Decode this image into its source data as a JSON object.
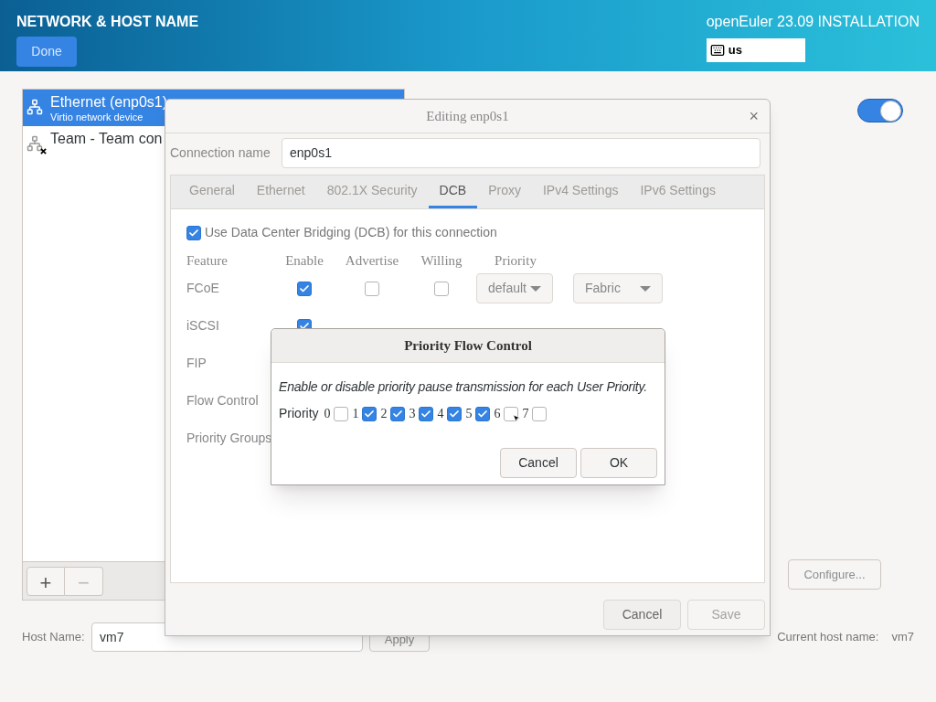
{
  "header": {
    "title": "NETWORK & HOST NAME",
    "done_button": "Done",
    "product": "openEuler 23.09 INSTALLATION",
    "keyboard_layout": "us"
  },
  "devices": [
    {
      "name": "Ethernet (enp0s1)",
      "detail": "Virtio network device",
      "selected": true,
      "connected": true
    },
    {
      "name": "Team - Team con",
      "selected": false,
      "connected": false
    }
  ],
  "device_toolbar": {
    "add": "+",
    "remove": "−"
  },
  "device_switch": {
    "on": true
  },
  "configure_button": "Configure...",
  "host": {
    "label": "Host Name:",
    "value": "vm7",
    "apply": "Apply",
    "current_label": "Current host name:",
    "current_value": "vm7"
  },
  "editor": {
    "title": "Editing enp0s1",
    "close": "×",
    "connection_label": "Connection name",
    "connection_value": "enp0s1",
    "tabs": [
      {
        "label": "General",
        "selected": false
      },
      {
        "label": "Ethernet",
        "selected": false
      },
      {
        "label": "802.1X Security",
        "selected": false
      },
      {
        "label": "DCB",
        "selected": true
      },
      {
        "label": "Proxy",
        "selected": false
      },
      {
        "label": "IPv4 Settings",
        "selected": false
      },
      {
        "label": "IPv6 Settings",
        "selected": false
      }
    ],
    "use_dcb": {
      "label": "Use Data Center Bridging (DCB) for this connection",
      "checked": true
    },
    "columns": [
      "Feature",
      "Enable",
      "Advertise",
      "Willing",
      "Priority"
    ],
    "features": [
      {
        "label": "FCoE",
        "enable": true,
        "advertise": false,
        "willing": false,
        "priority": "default",
        "mode": "Fabric"
      },
      {
        "label": "iSCSI",
        "enable": true
      },
      {
        "label": "FIP"
      },
      {
        "label": "Flow Control"
      },
      {
        "label": "Priority Groups"
      }
    ],
    "buttons": [
      {
        "label": "Cancel",
        "disabled": false
      },
      {
        "label": "Save",
        "disabled": true
      }
    ]
  },
  "pfc_dialog": {
    "title": "Priority Flow Control",
    "description": "Enable or disable priority pause transmission for each User Priority.",
    "priority_label": "Priority",
    "priorities": [
      {
        "label": "0",
        "checked": false
      },
      {
        "label": "1",
        "checked": true
      },
      {
        "label": "2",
        "checked": true
      },
      {
        "label": "3",
        "checked": true
      },
      {
        "label": "4",
        "checked": true
      },
      {
        "label": "5",
        "checked": true
      },
      {
        "label": "6",
        "checked": false
      },
      {
        "label": "7",
        "checked": false
      }
    ],
    "buttons": [
      "Cancel",
      "OK"
    ]
  }
}
